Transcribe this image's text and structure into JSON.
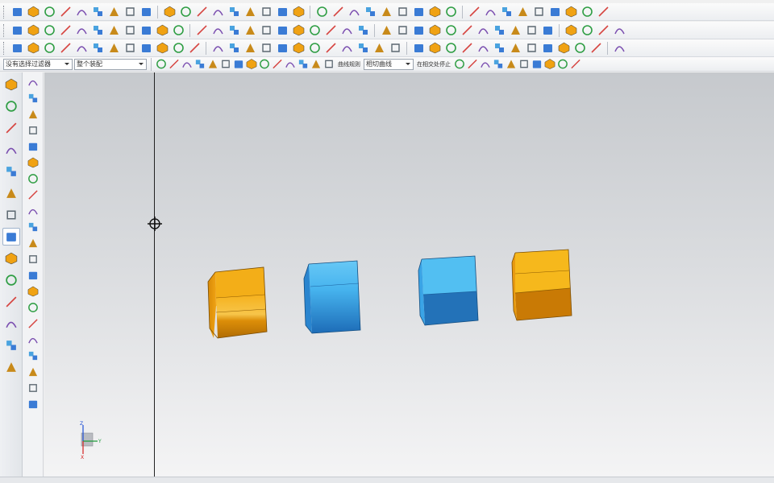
{
  "toolbar": {
    "row1_icons": [
      "app-logo-icon",
      "start-menu-icon",
      "new-file-icon",
      "open-folder-icon",
      "save-icon",
      "close-x-icon",
      "undo-icon",
      "redo-icon",
      "window-icon",
      "edit-tool-icon",
      "copy-object-icon",
      "fit-view-icon",
      "zoom-icon",
      "pan-icon",
      "rotate-icon",
      "perspective-icon",
      "render-mode-icon",
      "shaded-cube-icon",
      "wireframe-cube-icon",
      "view-orient-icon",
      "layer-icon",
      "snap-pointer-icon",
      "line-icon",
      "arc-icon",
      "spline-icon",
      "curve-icon",
      "trim-curve-icon",
      "offset-curve-icon",
      "bridge-curve-icon",
      "fillet-curve-icon",
      "chamfer-curve-icon",
      "rectangle-icon",
      "circle-icon",
      "ellipse-icon",
      "point-icon",
      "analysis-icon"
    ],
    "row2_icons": [
      "sketch-icon",
      "datum-icon",
      "extrude-icon",
      "revolve-icon",
      "hole-icon",
      "boss-icon",
      "pocket-icon",
      "pad-icon",
      "slot-icon",
      "groove-icon",
      "sphere-icon",
      "cylinder-icon",
      "cone-icon",
      "block-icon",
      "unite-icon",
      "subtract-icon",
      "intersect-icon",
      "edge-blend-icon",
      "chamfer-icon",
      "shell-icon",
      "draft-icon",
      "offset-face-icon",
      "thicken-icon",
      "mirror-icon",
      "pattern-icon",
      "trim-body-icon",
      "split-body-icon",
      "sew-icon",
      "patch-icon",
      "replace-face-icon",
      "move-face-icon",
      "measure-icon",
      "section-icon",
      "info-icon",
      "inspect-icon",
      "hide-icon",
      "show-icon"
    ],
    "row3_icons": [
      "surface-icon",
      "ruled-icon",
      "through-curves-icon",
      "swept-icon",
      "n-sided-icon",
      "bounded-plane-icon",
      "trim-sheet-icon",
      "extension-icon",
      "law-icon",
      "blend-face-icon",
      "styled-blend-icon",
      "offset-surface-icon",
      "silhouette-icon",
      "x-form-icon",
      "iso-curve-icon",
      "face-analysis-icon",
      "curvature-icon",
      "reflection-icon",
      "highlight-icon",
      "color-icon",
      "material-icon",
      "light-icon",
      "camera-icon",
      "texture-icon",
      "decal-icon",
      "studio-icon",
      "render-icon",
      "line-tool-icon",
      "polyline-icon",
      "rect-tool-icon",
      "polygon-icon",
      "text-icon",
      "dimension-icon",
      "note-icon",
      "symbol-icon",
      "table-icon",
      "draw-icon"
    ],
    "selection_filter_label": "没有选择过滤器",
    "selection_scope_label": "整个装配",
    "row4_text_1": "曲线规则",
    "row4_text_2": "相切曲线",
    "row4_text_3": "在相交处停止"
  },
  "resource_bar": {
    "icons": [
      "roles-icon",
      "assembly-navigator-icon",
      "constraint-navigator-icon",
      "part-navigator-icon",
      "reuse-library-icon",
      "web-browser-icon",
      "history-icon",
      "system-materials-icon",
      "process-studio-icon",
      "manufacturing-wizard-icon",
      "palette-icon",
      "roles-settings-icon",
      "analysis-navigator-icon",
      "view-manager-icon"
    ],
    "active_index": 7
  },
  "side_tools": {
    "icons": [
      "select-icon",
      "cube-tool-icon",
      "frame-icon",
      "curve-tool-icon",
      "gear-tool-icon",
      "block-tool-icon",
      "book-icon",
      "hammer-icon",
      "lamp-icon",
      "box-outline-icon",
      "funnel-icon",
      "layers-tool-icon",
      "triangle-tool-icon",
      "chart-tool-icon",
      "photo-tool-icon",
      "tree-tool-icon",
      "stamp-icon",
      "grid-tool-icon",
      "sheet-icon",
      "cloud-tool-icon",
      "palette-tool-icon"
    ]
  },
  "viewport": {
    "cube_colors": [
      "#f0a213",
      "#3fb3ef",
      "#2f95dc",
      "#f5b018"
    ],
    "triad_labels": {
      "x": "X",
      "y": "Y",
      "z": "Z"
    }
  },
  "colors": {
    "accent": "#1e73be",
    "viewport_top": "#c6c9cd",
    "viewport_bottom": "#f4f4f5",
    "orange": "#f0a213",
    "blue": "#3fb3ef"
  }
}
